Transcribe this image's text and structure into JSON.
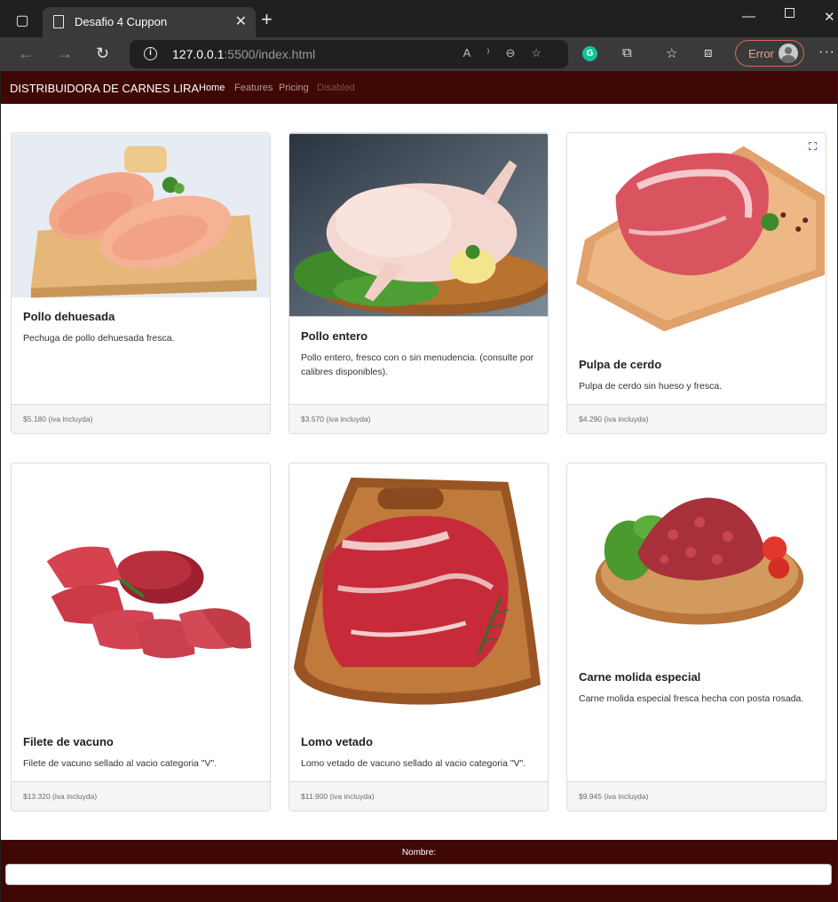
{
  "browser": {
    "tab_title": "Desafio 4 Cuppon",
    "url_host": "127.0.0.1",
    "url_rest": ":5500/index.html",
    "profile_status": "Error"
  },
  "navbar": {
    "brand": "DISTRIBUIDORA DE CARNES LIRA",
    "links": [
      {
        "label": "Home"
      },
      {
        "label": "Features"
      },
      {
        "label": "Pricing"
      },
      {
        "label": "Disabled"
      }
    ]
  },
  "products": [
    {
      "title": "Pollo dehuesada",
      "description": "Pechuga de pollo dehuesada fresca.",
      "price": "$5.180 (iva incluyda)",
      "image": "chicken-breast-on-board"
    },
    {
      "title": "Pollo entero",
      "description": "Pollo entero, fresco con o sin menudencia. (consulte por calibres disponibles).",
      "price": "$3.570 (iva incluyda)",
      "image": "whole-chicken-on-board"
    },
    {
      "title": "Pulpa de cerdo",
      "description": "Pulpa de cerdo sin hueso y fresca.",
      "price": "$4.290 (iva incluyda)",
      "image": "pork-shoulder-on-board"
    },
    {
      "title": "Filete de vacuno",
      "description": "Filete de vacuno sellado al vacio categoria \"V\".",
      "price": "$13.320 (iva incluyda)",
      "image": "sliced-beef-fillet"
    },
    {
      "title": "Lomo vetado",
      "description": "Lomo vetado de vacuno sellado al vacio categoria \"V\".",
      "price": "$11.900 (iva incluyda)",
      "image": "ribeye-on-wood-board"
    },
    {
      "title": "Carne molida especial",
      "description": "Carne molida especial fresca hecha con posta rosada.",
      "price": "$9.945 (iva incluyda)",
      "image": "ground-beef-on-plate"
    }
  ],
  "form": {
    "name_label": "Nombre:",
    "name_value": ""
  }
}
